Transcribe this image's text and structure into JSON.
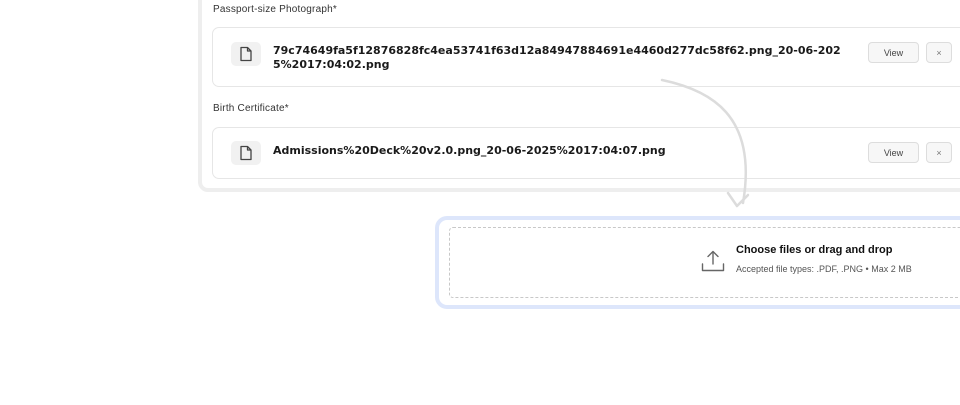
{
  "passport": {
    "label": "Passport-size Photograph*",
    "file_name": "79c74649fa5f12876828fc4ea53741f63d12a84947884691e4460d277dc58f62.png_20-06-2025%2017:04:02.png",
    "view_label": "View",
    "remove_label": "×"
  },
  "birth_certificate": {
    "label": "Birth Certificate*",
    "file_name": "Admissions%20Deck%20v2.0.png_20-06-2025%2017:04:07.png",
    "view_label": "View",
    "remove_label": "×"
  },
  "dropzone": {
    "title": "Choose files or drag and drop",
    "subtitle": "Accepted file types: .PDF, .PNG • Max 2 MB"
  },
  "icons": {
    "file": "document-icon",
    "upload": "upload-icon",
    "arrow": "curved-arrow-icon"
  },
  "colors": {
    "dropzone_border": "#dde6fb",
    "card_border": "#e6e6e6"
  }
}
